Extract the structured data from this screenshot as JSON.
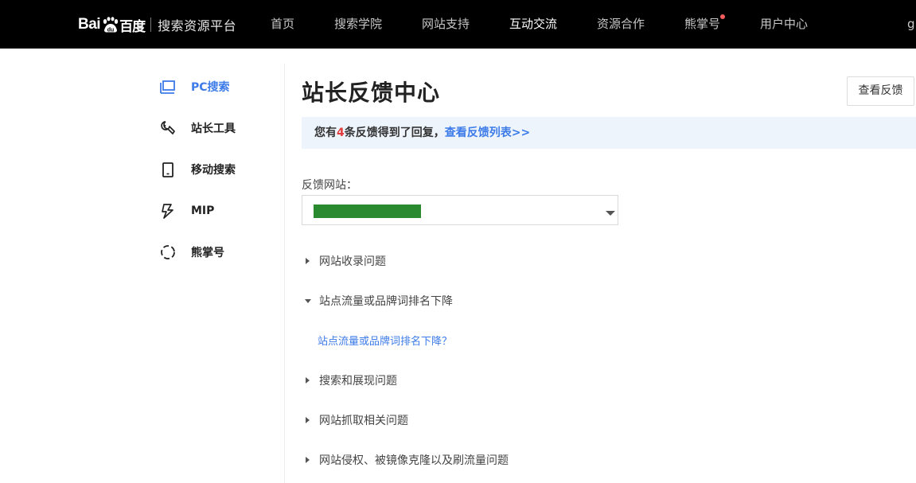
{
  "header": {
    "logo": {
      "text_latin": "Bai",
      "text_du": "du",
      "text_cn": "百度",
      "subtitle": "搜索资源平台"
    },
    "nav": [
      {
        "label": "首页",
        "active": false
      },
      {
        "label": "搜索学院",
        "active": false
      },
      {
        "label": "网站支持",
        "active": false
      },
      {
        "label": "互动交流",
        "active": true
      },
      {
        "label": "资源合作",
        "active": false
      },
      {
        "label": "熊掌号",
        "active": false,
        "badge": true
      },
      {
        "label": "用户中心",
        "active": false
      }
    ],
    "user_partial": "g"
  },
  "sidebar": {
    "items": [
      {
        "label": "PC搜索",
        "icon": "monitor-icon",
        "active": true
      },
      {
        "label": "站长工具",
        "icon": "wrench-icon",
        "active": false
      },
      {
        "label": "移动搜索",
        "icon": "mobile-icon",
        "active": false
      },
      {
        "label": "MIP",
        "icon": "lightning-icon",
        "active": false
      },
      {
        "label": "熊掌号",
        "icon": "dashed-circle-icon",
        "active": false
      }
    ]
  },
  "main": {
    "title": "站长反馈中心",
    "view_feedback_button": "查看反馈",
    "notice": {
      "prefix": "您有",
      "count": "4",
      "suffix": "条反馈得到了回复，",
      "link": "查看反馈列表>>"
    },
    "site_field": {
      "label": "反馈网站："
    },
    "faq": [
      {
        "label": "网站收录问题",
        "expanded": false
      },
      {
        "label": "站点流量或品牌词排名下降",
        "expanded": true,
        "children": [
          "站点流量或品牌词排名下降？"
        ]
      },
      {
        "label": "搜索和展现问题",
        "expanded": false
      },
      {
        "label": "网站抓取相关问题",
        "expanded": false
      },
      {
        "label": "网站侵权、被镜像克隆以及刷流量问题",
        "expanded": false
      }
    ]
  },
  "colors": {
    "topbar": "#000000",
    "accent": "#3c7be8",
    "count_red": "#e33b3b",
    "notice_bg": "#eef4fc",
    "redacted_green": "#2a8a2f"
  }
}
